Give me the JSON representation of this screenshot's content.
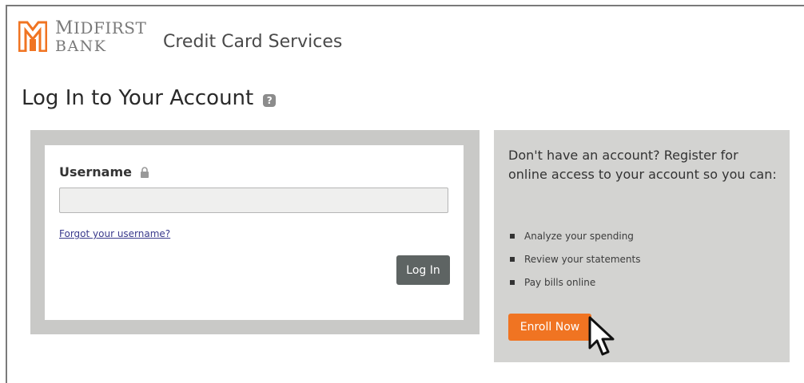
{
  "header": {
    "logo_line1_first": "M",
    "logo_line1_rest": "IDF",
    "logo_line1_first2": "",
    "logo_line1_tail": "IRST",
    "logo_line2": "BANK",
    "service_title": "Credit Card Services"
  },
  "page": {
    "title": "Log In to Your Account",
    "help_icon": "question-icon"
  },
  "login": {
    "username_label": "Username",
    "lock_icon": "lock-icon",
    "username_value": "",
    "username_placeholder": "",
    "forgot_link": "Forgot your username?",
    "login_button": "Log In"
  },
  "register": {
    "text": "Don't have an account? Register for online access to your account so you can:",
    "benefits": [
      "Analyze your spending",
      "Review your statements",
      "Pay bills online"
    ],
    "enroll_button": "Enroll Now"
  },
  "colors": {
    "brand_orange": "#f07422",
    "login_button_bg": "#5e6463",
    "panel_gray": "#c9c9c7",
    "register_panel_gray": "#d3d3d1",
    "link_blue": "#3a3a8c"
  }
}
